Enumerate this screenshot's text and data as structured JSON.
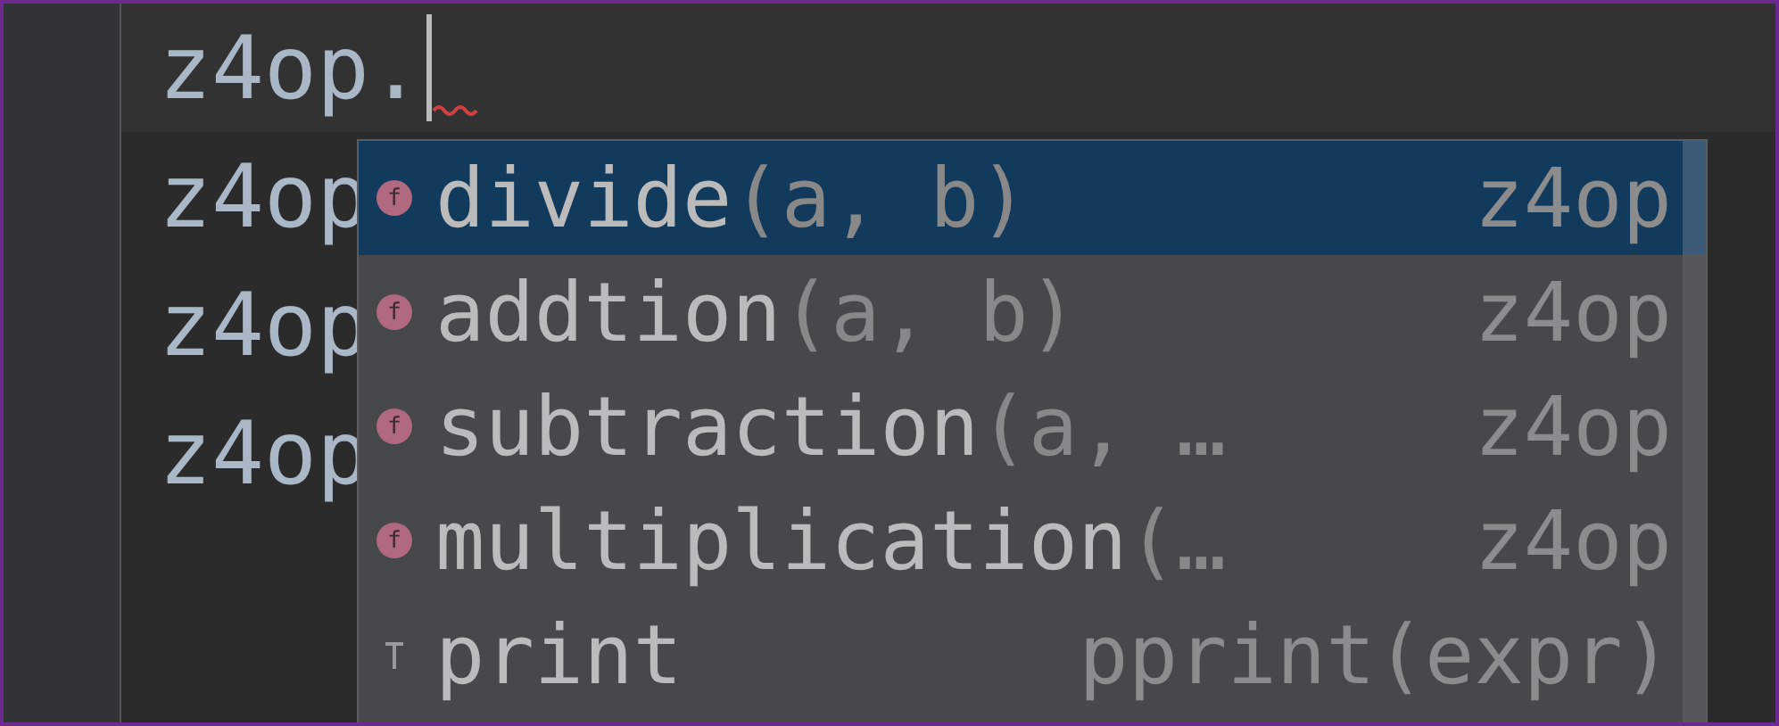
{
  "editor": {
    "current_line": "z4op.",
    "lines": [
      "z4op",
      "z4op",
      "z4op"
    ]
  },
  "completion": {
    "items": [
      {
        "kind": "function",
        "icon_letter": "f",
        "name": "divide",
        "params": "(a, b)",
        "type": "z4op",
        "selected": true
      },
      {
        "kind": "function",
        "icon_letter": "f",
        "name": "addtion",
        "params": "(a, b)",
        "type": "z4op",
        "selected": false
      },
      {
        "kind": "function",
        "icon_letter": "f",
        "name": "subtraction",
        "params": "(a, …",
        "type": "z4op",
        "selected": false
      },
      {
        "kind": "function",
        "icon_letter": "f",
        "name": "multiplication",
        "params": "(…",
        "type": "z4op",
        "selected": false
      },
      {
        "kind": "template",
        "name": "print",
        "type": "pprint(expr)",
        "selected": false
      }
    ]
  }
}
